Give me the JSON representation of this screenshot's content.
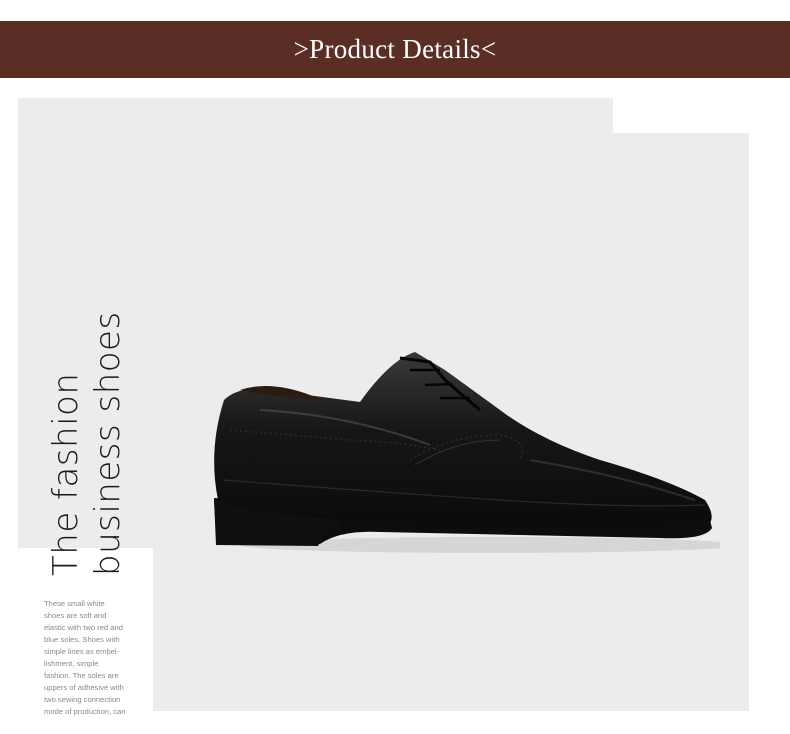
{
  "header": {
    "title": ">Product Details<"
  },
  "hero": {
    "line1": "The fashion",
    "line2": "business shoes"
  },
  "description": {
    "lines": [
      "These small white",
      "shoes are soft and",
      "elastic with two red and",
      "blue soles. Shoes with",
      "simple lines as embel-",
      "lishment, simple",
      "fashion. The soles are",
      "uppers of adhesive with",
      "two sewing connection",
      "mode of production, can"
    ]
  },
  "colors": {
    "header_bg": "#5a2e25",
    "panel_bg": "#ececec",
    "shoe": "#151515"
  },
  "image": {
    "subject": "black-leather-brogue-shoe"
  }
}
